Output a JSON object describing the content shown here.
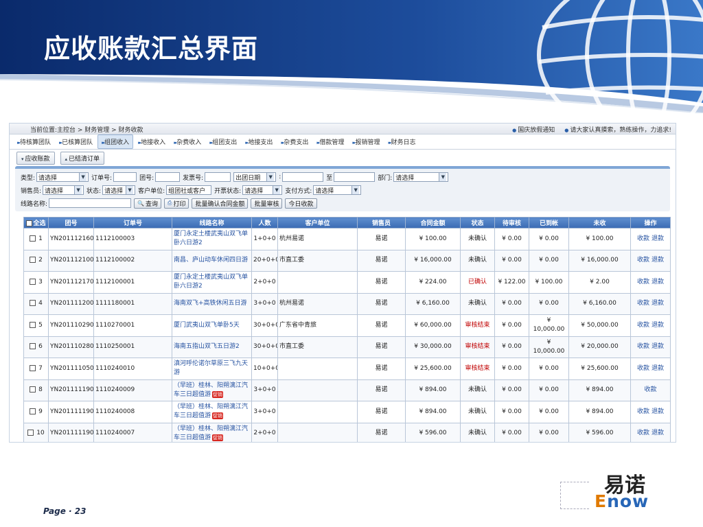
{
  "slide": {
    "title": "应收账款汇总界面",
    "page_label": "Page · 23"
  },
  "logo": {
    "cn": "易诺",
    "en_first": "E",
    "en_rest": "now"
  },
  "app": {
    "breadcrumb": "当前位置:主控台 > 财务管理 > 财务收款",
    "notices": [
      "国庆放假通知",
      "请大家认真摸索，熟练操作，力追求!"
    ],
    "nav": [
      {
        "label": "待核算团队",
        "active": false
      },
      {
        "label": "已核算团队",
        "active": false
      },
      {
        "label": "组团收入",
        "active": true
      },
      {
        "label": "地接收入",
        "active": false
      },
      {
        "label": "杂费收入",
        "active": false
      },
      {
        "label": "组团支出",
        "active": false
      },
      {
        "label": "地接支出",
        "active": false
      },
      {
        "label": "杂费支出",
        "active": false
      },
      {
        "label": "借款管理",
        "active": false
      },
      {
        "label": "报销管理",
        "active": false
      },
      {
        "label": "财务日志",
        "active": false
      }
    ],
    "subtabs": [
      "应收账款",
      "已结清订单"
    ],
    "filters": {
      "type_label": "类型:",
      "type_value": "请选择",
      "order_no_label": "订单号:",
      "group_no_label": "团号:",
      "invoice_no_label": "发票号:",
      "date_type_value": "出团日期",
      "date_sep": ":",
      "date_to": "至",
      "dept_label": "部门:",
      "dept_value": "请选择",
      "seller_label": "销售员:",
      "seller_value": "请选择",
      "status_label": "状态:",
      "status_value": "请选择",
      "customer_label": "客户单位:",
      "customer_value": "组团社或客户",
      "invoice_status_label": "开票状态:",
      "invoice_status_value": "请选择",
      "pay_label": "支付方式:",
      "pay_value": "请选择",
      "route_label": "线路名称:",
      "query_btn": "查询",
      "print_btn": "打印",
      "batch_confirm_btn": "批量确认合同金额",
      "batch_audit_btn": "批量审核",
      "today_btn": "今日收款"
    },
    "columns": [
      "全选",
      "团号",
      "订单号",
      "线路名称",
      "人数",
      "客户单位",
      "销售员",
      "合同金额",
      "状态",
      "待审核",
      "已到帐",
      "未收",
      "操作"
    ],
    "action_receive": "收款",
    "action_refund": "退款",
    "promo_label": "促销",
    "rows": [
      {
        "idx": "1",
        "group": "YN2011121600082",
        "order": "1112100003",
        "route": "厦门永定土楼武夷山双飞单卧六日游2",
        "promo": false,
        "people": "1+0+0",
        "customer": "杭州易诺",
        "seller": "易诺",
        "amount": "¥ 100.00",
        "status": "未确认",
        "status_red": false,
        "pending": "¥ 0.00",
        "received": "¥ 0.00",
        "unpaid": "¥ 100.00",
        "refund": true
      },
      {
        "idx": "2",
        "group": "YN2011121000084",
        "order": "1112100002",
        "route": "南昌、庐山动车休闲四日游",
        "promo": false,
        "people": "20+0+0",
        "customer": "市直工委",
        "seller": "易诺",
        "amount": "¥ 16,000.00",
        "status": "未确认",
        "status_red": false,
        "pending": "¥ 0.00",
        "received": "¥ 0.00",
        "unpaid": "¥ 16,000.00",
        "refund": true
      },
      {
        "idx": "3",
        "group": "YN2011121700083",
        "order": "1112100001",
        "route": "厦门永定土楼武夷山双飞单卧六日游2",
        "promo": false,
        "people": "2+0+0",
        "customer": "",
        "seller": "易诺",
        "amount": "¥ 224.00",
        "status": "已确认",
        "status_red": true,
        "pending": "¥ 122.00",
        "received": "¥ 100.00",
        "unpaid": "¥ 2.00",
        "refund": true
      },
      {
        "idx": "4",
        "group": "YN2011112000060",
        "order": "1111180001",
        "route": "海南双飞+高铁休闲五日游",
        "promo": false,
        "people": "3+0+0",
        "customer": "杭州易诺",
        "seller": "易诺",
        "amount": "¥ 6,160.00",
        "status": "未确认",
        "status_red": false,
        "pending": "¥ 0.00",
        "received": "¥ 0.00",
        "unpaid": "¥ 6,160.00",
        "refund": true
      },
      {
        "idx": "5",
        "group": "YN2011102900081",
        "order": "1110270001",
        "route": "厦门武夷山双飞单卧5天",
        "promo": false,
        "people": "30+0+0",
        "customer": "广东省中青旅",
        "seller": "易诺",
        "amount": "¥ 60,000.00",
        "status": "审核结束",
        "status_red": true,
        "pending": "¥ 0.00",
        "received": "¥ 10,000.00",
        "unpaid": "¥ 50,000.00",
        "refund": true
      },
      {
        "idx": "6",
        "group": "YN2011102800080",
        "order": "1110250001",
        "route": "海南五指山双飞五日游2",
        "promo": false,
        "people": "30+0+0",
        "customer": "市直工委",
        "seller": "易诺",
        "amount": "¥ 30,000.00",
        "status": "审核结束",
        "status_red": true,
        "pending": "¥ 0.00",
        "received": "¥ 10,000.00",
        "unpaid": "¥ 20,000.00",
        "refund": true
      },
      {
        "idx": "7",
        "group": "YN2011110500040",
        "order": "1110240010",
        "route": "滇河呼伦诺尔草原三飞九天游",
        "promo": false,
        "people": "10+0+0",
        "customer": "",
        "seller": "易诺",
        "amount": "¥ 25,600.00",
        "status": "审核结束",
        "status_red": true,
        "pending": "¥ 0.00",
        "received": "¥ 0.00",
        "unpaid": "¥ 25,600.00",
        "refund": true
      },
      {
        "idx": "8",
        "group": "YN2011111900037",
        "order": "1110240009",
        "route": "（早班）桂林、阳朔漓江汽车三日超值游",
        "promo": true,
        "people": "3+0+0",
        "customer": "",
        "seller": "易诺",
        "amount": "¥ 894.00",
        "status": "未确认",
        "status_red": false,
        "pending": "¥ 0.00",
        "received": "¥ 0.00",
        "unpaid": "¥ 894.00",
        "refund": false
      },
      {
        "idx": "9",
        "group": "YN2011111900037",
        "order": "1110240008",
        "route": "（早班）桂林、阳朔漓江汽车三日超值游",
        "promo": true,
        "people": "3+0+0",
        "customer": "",
        "seller": "易诺",
        "amount": "¥ 894.00",
        "status": "未确认",
        "status_red": false,
        "pending": "¥ 0.00",
        "received": "¥ 0.00",
        "unpaid": "¥ 894.00",
        "refund": true
      },
      {
        "idx": "10",
        "group": "YN2011111900037",
        "order": "1110240007",
        "route": "（早班）桂林、阳朔漓江汽车三日超值游",
        "promo": true,
        "people": "2+0+0",
        "customer": "",
        "seller": "易诺",
        "amount": "¥ 596.00",
        "status": "未确认",
        "status_red": false,
        "pending": "¥ 0.00",
        "received": "¥ 0.00",
        "unpaid": "¥ 596.00",
        "refund": true
      }
    ]
  }
}
